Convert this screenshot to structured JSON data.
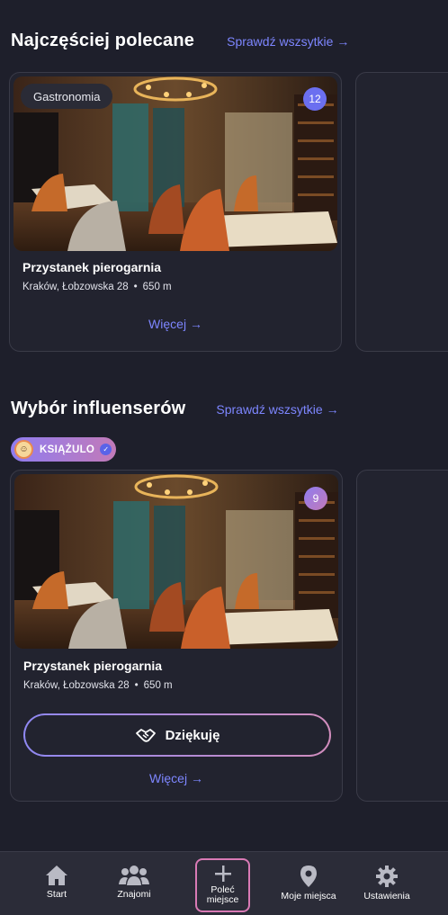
{
  "section1": {
    "title": "Najczęściej polecane",
    "see_all": "Sprawdź wszsytkie",
    "arrow": "→",
    "card": {
      "tag": "Gastronomia",
      "count": "12",
      "name": "Przystanek pierogarnia",
      "address": "Kraków, Łobzowska 28",
      "distance": "650 m",
      "more": "Więcej"
    }
  },
  "section2": {
    "title": "Wybór influenserów",
    "see_all": "Sprawdź wszsytkie",
    "arrow": "→",
    "influencer": {
      "name": "KSIĄŻULO"
    },
    "card": {
      "count": "9",
      "name": "Przystanek pierogarnia",
      "address": "Kraków, Łobzowska 28",
      "distance": "650 m",
      "thanks": "Dziękuję",
      "more": "Więcej"
    }
  },
  "bottom_nav": {
    "items": [
      {
        "label": "Start",
        "icon": "home-icon"
      },
      {
        "label": "Znajomi",
        "icon": "friends-icon"
      },
      {
        "label": "Poleć miejsce",
        "icon": "plus-icon"
      },
      {
        "label": "Moje miejsca",
        "icon": "map-pin-icon"
      },
      {
        "label": "Ustawienia",
        "icon": "gear-icon"
      }
    ]
  },
  "colors": {
    "background": "#1e1f2b",
    "accent": "#7d86ff",
    "badge_blue": "#6b6ff0",
    "cta_border": "#d97ab5"
  }
}
